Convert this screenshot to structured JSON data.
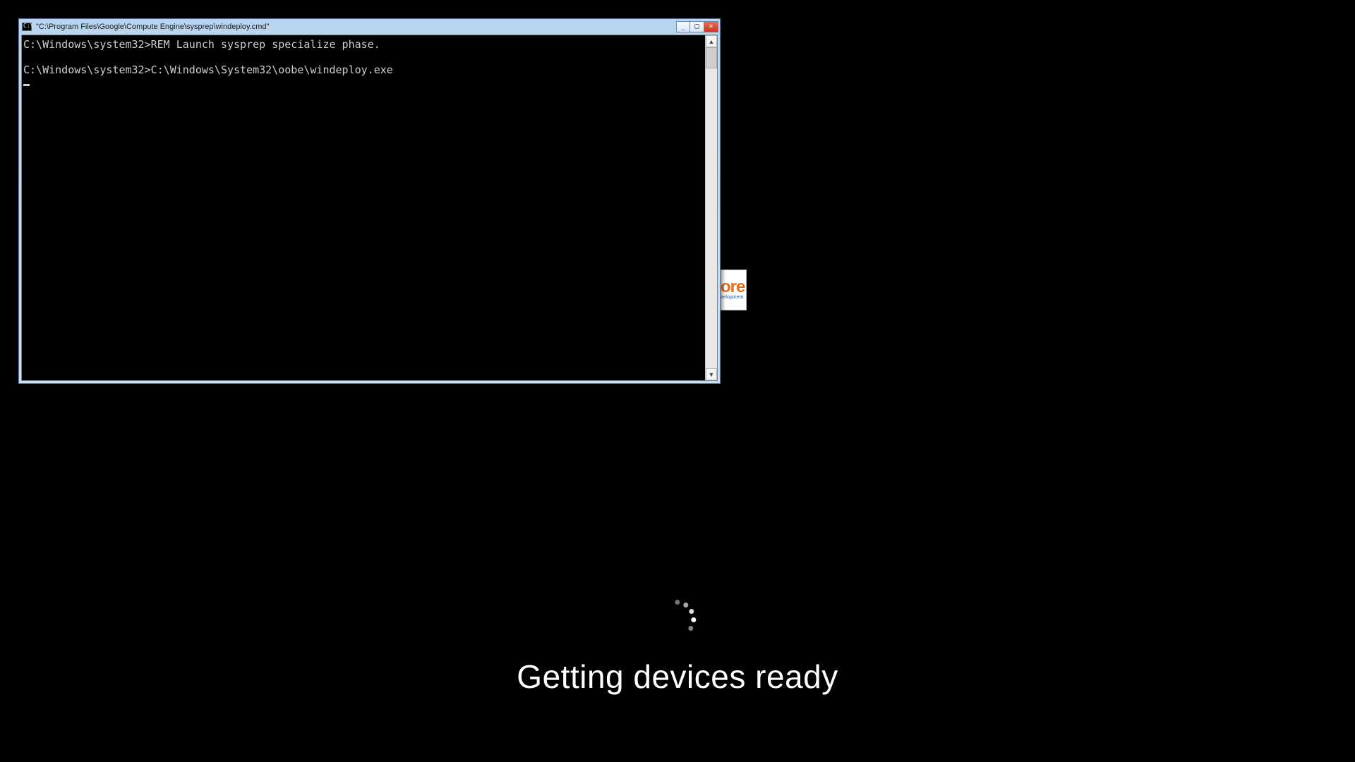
{
  "oobe": {
    "status_text": "Getting devices ready"
  },
  "logo": {
    "fragment_big": "ore",
    "fragment_small": "velopment"
  },
  "window": {
    "title": "\"C:\\Program Files\\Google\\Compute Engine\\sysprep\\windeploy.cmd\"",
    "terminal_lines": [
      "C:\\Windows\\system32>REM Launch sysprep specialize phase.",
      "",
      "C:\\Windows\\system32>C:\\Windows\\System32\\oobe\\windeploy.exe"
    ]
  },
  "icons": {
    "minimize_glyph": "_",
    "maximize_glyph": "□",
    "close_glyph": "×",
    "scroll_up_glyph": "▲",
    "scroll_down_glyph": "▼"
  }
}
